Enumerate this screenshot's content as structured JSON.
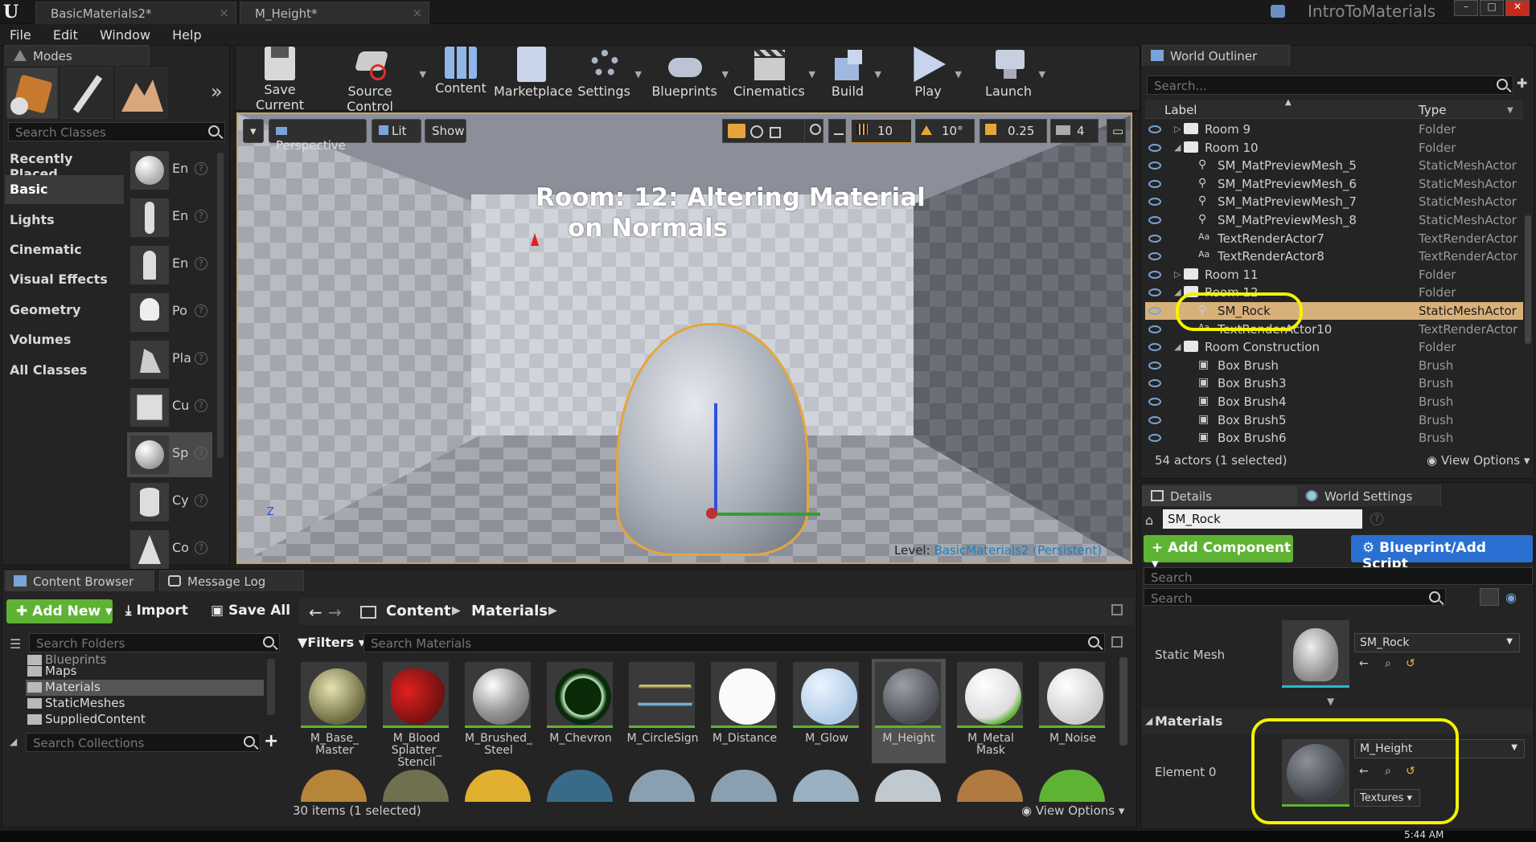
{
  "window": {
    "tabs": [
      "BasicMaterials2*",
      "M_Height*"
    ],
    "project_name": "IntroToMaterials"
  },
  "menu": [
    "File",
    "Edit",
    "Window",
    "Help"
  ],
  "modes": {
    "tab_label": "Modes",
    "search_placeholder": "Search Classes",
    "categories": [
      "Recently Placed",
      "Basic",
      "Lights",
      "Cinematic",
      "Visual Effects",
      "Geometry",
      "Volumes",
      "All Classes"
    ],
    "selected_category": "Basic",
    "items": [
      "En",
      "En",
      "En",
      "Po",
      "Pla",
      "Cu",
      "Sp",
      "Cy",
      "Co"
    ]
  },
  "toolbar": {
    "buttons": [
      "Save Current",
      "Source Control",
      "Content",
      "Marketplace",
      "Settings",
      "Blueprints",
      "Cinematics",
      "Build",
      "Play",
      "Launch"
    ]
  },
  "viewport": {
    "perspective": "Perspective",
    "lit": "Lit",
    "show": "Show",
    "grid": "10",
    "rotation": "10°",
    "scale": "0.25",
    "camera_speed": "4",
    "room_text_line1": "Room: 12: Altering Material",
    "room_text_line2": "on Normals",
    "level_label": "Level:",
    "level_name": "BasicMaterials2 (Persistent)"
  },
  "outliner": {
    "tab_label": "World Outliner",
    "search_placeholder": "Search...",
    "col_label": "Label",
    "col_type": "Type",
    "rows": [
      {
        "label": "Room 9",
        "type": "Folder"
      },
      {
        "label": "Room 10",
        "type": "Folder"
      },
      {
        "label": "SM_MatPreviewMesh_5",
        "type": "StaticMeshActor"
      },
      {
        "label": "SM_MatPreviewMesh_6",
        "type": "StaticMeshActor"
      },
      {
        "label": "SM_MatPreviewMesh_7",
        "type": "StaticMeshActor"
      },
      {
        "label": "SM_MatPreviewMesh_8",
        "type": "StaticMeshActor"
      },
      {
        "label": "TextRenderActor7",
        "type": "TextRenderActor"
      },
      {
        "label": "TextRenderActor8",
        "type": "TextRenderActor"
      },
      {
        "label": "Room 11",
        "type": "Folder"
      },
      {
        "label": "Room 12",
        "type": "Folder"
      },
      {
        "label": "SM_Rock",
        "type": "StaticMeshActor"
      },
      {
        "label": "TextRenderActor10",
        "type": "TextRenderActor"
      },
      {
        "label": "Room Construction",
        "type": "Folder"
      },
      {
        "label": "Box Brush",
        "type": "Brush"
      },
      {
        "label": "Box Brush3",
        "type": "Brush"
      },
      {
        "label": "Box Brush4",
        "type": "Brush"
      },
      {
        "label": "Box Brush5",
        "type": "Brush"
      },
      {
        "label": "Box Brush6",
        "type": "Brush"
      }
    ],
    "status": "54 actors (1 selected)",
    "view_options": "View Options"
  },
  "details": {
    "tab_label": "Details",
    "world_settings_tab": "World Settings",
    "actor_name": "SM_Rock",
    "add_component": "+ Add Component",
    "blueprint_script": "Blueprint/Add Script",
    "search_placeholder": "Search",
    "search2_placeholder": "Search",
    "static_mesh_label": "Static Mesh",
    "static_mesh_value": "SM_Rock",
    "materials_header": "Materials",
    "element_label": "Element 0",
    "material_value": "M_Height",
    "textures_label": "Textures"
  },
  "content_browser": {
    "tab_label": "Content Browser",
    "message_log_tab": "Message Log",
    "add_new": "Add New",
    "import": "Import",
    "save_all": "Save All",
    "path": [
      "Content",
      "Materials"
    ],
    "folder_search_placeholder": "Search Folders",
    "folders": [
      "Blueprints",
      "Maps",
      "Materials",
      "StaticMeshes",
      "SuppliedContent"
    ],
    "selected_folder": "Materials",
    "collections_placeholder": "Search Collections",
    "filters": "Filters",
    "asset_search_placeholder": "Search Materials",
    "assets": [
      "M_Base_\nMaster",
      "M_Blood\nSplatter_\nStencil",
      "M_Brushed_\nSteel",
      "M_Chevron",
      "M_CircleSign",
      "M_Distance",
      "M_Glow",
      "M_Height",
      "M_Metal\nMask",
      "M_Noise"
    ],
    "selected_asset": "M_Height",
    "status": "30 items (1 selected)",
    "view_options": "View Options"
  },
  "taskbar": {
    "time": "5:44 AM"
  },
  "colors": {
    "accent_green": "#5fb334",
    "accent_blue": "#2a6fd2",
    "highlight_yellow": "#f5f200",
    "selection": "#d8b07a"
  }
}
